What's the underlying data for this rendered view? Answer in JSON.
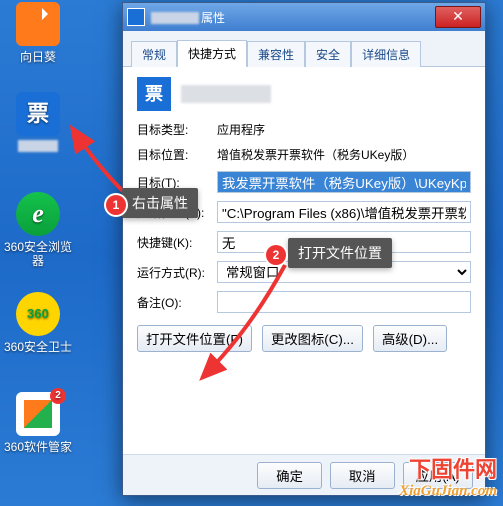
{
  "desktop": {
    "icons": [
      {
        "label": "向日葵"
      },
      {
        "label": ""
      },
      {
        "label": "360安全浏览器"
      },
      {
        "label": "360安全卫士"
      },
      {
        "label": "360软件管家",
        "badge": "2"
      }
    ]
  },
  "dialog": {
    "title_suffix": "属性",
    "close_glyph": "✕",
    "tabs": [
      "常规",
      "快捷方式",
      "兼容性",
      "安全",
      "详细信息"
    ],
    "active_tab": 1,
    "app_icon_glyph": "票",
    "fields": {
      "type_k": "目标类型:",
      "type_v": "应用程序",
      "loc_k": "目标位置:",
      "loc_v": "增值税发票开票软件（税务UKey版）",
      "target_k": "目标(T):",
      "target_v": "我发票开票软件（税务UKey版）\\UKeyKp.exe\"",
      "start_k": "起始位置(S):",
      "start_v": "\"C:\\Program Files (x86)\\增值税发票开票软",
      "hotkey_k": "快捷键(K):",
      "hotkey_v": "无",
      "run_k": "运行方式(R):",
      "run_v": "常规窗口",
      "comment_k": "备注(O):",
      "comment_v": ""
    },
    "buttons": {
      "open_loc": "打开文件位置(F)",
      "change_icon": "更改图标(C)...",
      "advanced": "高级(D)..."
    },
    "footer": {
      "ok": "确定",
      "cancel": "取消",
      "apply": "应用(A)"
    }
  },
  "annotations": {
    "n1": "1",
    "n2": "2",
    "callout1": "右击属性",
    "callout2": "打开文件位置"
  },
  "watermark": {
    "cn": "下固件网",
    "en": "XiaGuJian.com"
  }
}
